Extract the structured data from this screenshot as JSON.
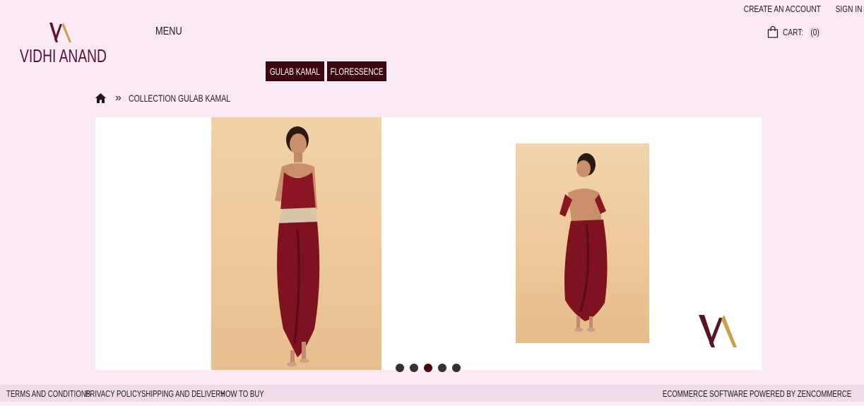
{
  "account": {
    "create_account": "CREATE AN ACCOUNT",
    "sign_in": "SIGN IN"
  },
  "logo": {
    "brand": "VIDHI ANAND",
    "mark": "VA"
  },
  "nav": {
    "menu": "MENU"
  },
  "cart": {
    "label": "CART:",
    "count": "(0)",
    "icon": "shopping-bag-icon"
  },
  "collections": [
    {
      "label": "GULAB KAMAL"
    },
    {
      "label": "FLORESSENCE"
    }
  ],
  "breadcrumb": {
    "separator": "»",
    "current": "COLLECTION GULAB KAMAL",
    "home_icon": "home-icon"
  },
  "slider": {
    "images": [
      {
        "alt": "model-front-maroon-drape-dress"
      },
      {
        "alt": "model-back-maroon-drape-dress"
      }
    ],
    "dots": 5,
    "active_dot": 3
  },
  "footer": {
    "links": [
      "TERMS AND CONDITIONS",
      "PRIVACY POLICY",
      "SHIPPING AND DELIVERY",
      "HOW TO BUY"
    ],
    "powered_by": "ECOMMERCE SOFTWARE POWERED BY ZENCOMMERCE"
  },
  "colors": {
    "background": "#fbe9f6",
    "accent": "#3e0710",
    "brand": "#5a1424",
    "gold": "#c9a04a"
  }
}
